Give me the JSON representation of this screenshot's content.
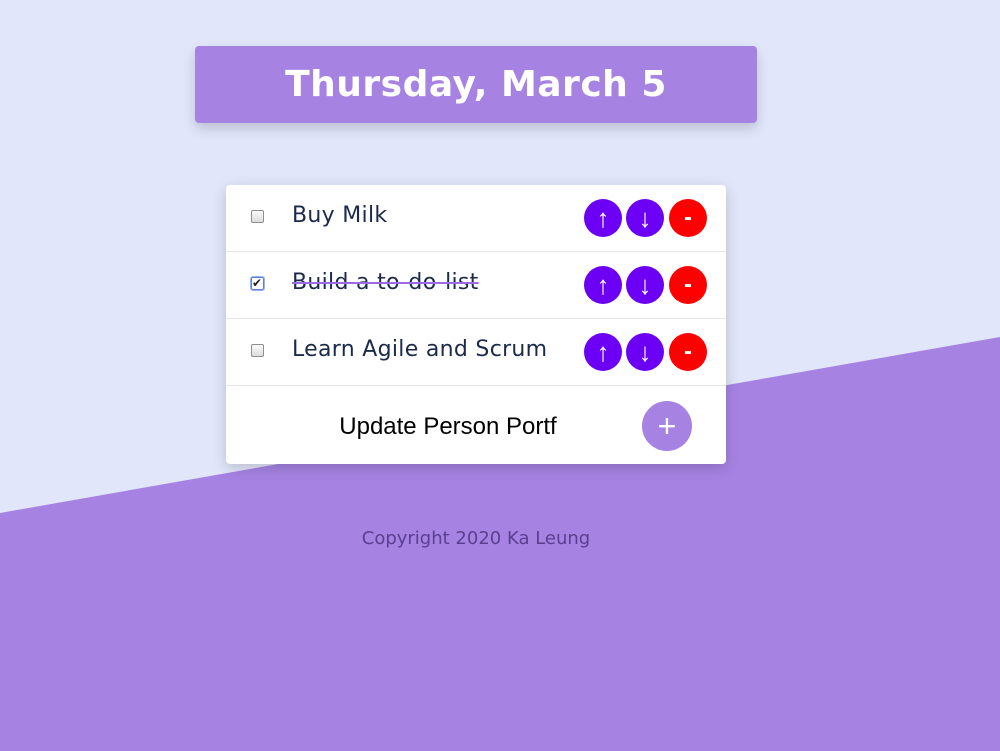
{
  "header": {
    "date": "Thursday, March 5"
  },
  "todos": [
    {
      "text": "Buy Milk",
      "done": false,
      "up_icon": "↑",
      "down_icon": "↓",
      "delete_icon": "-"
    },
    {
      "text": "Build a to-do-list",
      "done": true,
      "up_icon": "↑",
      "down_icon": "↓",
      "delete_icon": "-"
    },
    {
      "text": "Learn Agile and Scrum",
      "done": false,
      "up_icon": "↑",
      "down_icon": "↓",
      "delete_icon": "-"
    }
  ],
  "new_item": {
    "value": "Update Person Portf",
    "add_icon": "+"
  },
  "footer": {
    "copyright": "Copyright 2020 Ka Leung"
  },
  "colors": {
    "background": "#e1e6fa",
    "accent": "#a683e3",
    "move_button": "#6b00f5",
    "delete_button": "#ff0000"
  }
}
